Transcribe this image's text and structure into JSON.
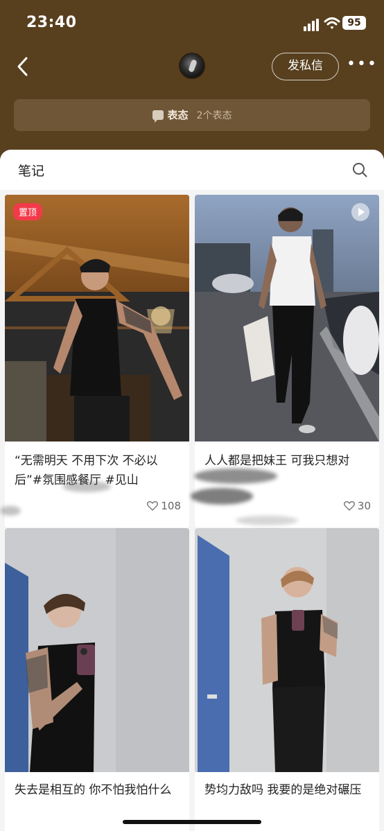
{
  "status_bar": {
    "time": "23:40",
    "battery": "95"
  },
  "header": {
    "dm_label": "发私信",
    "more_label": "•••"
  },
  "attitude": {
    "label": "表态",
    "count": "2个表态"
  },
  "notes": {
    "title": "笔记"
  },
  "cards": [
    {
      "badge": "置顶",
      "caption": "“无需明天 不用下次 不必以后”#氛围感餐厅 #见山",
      "likes": "108"
    },
    {
      "caption": "人人都是把妹王 可我只想对",
      "likes": "30"
    },
    {
      "caption": "失去是相互的 你不怕我怕什么"
    },
    {
      "caption": "势均力敌吗 我要的是绝对碾压"
    }
  ],
  "colors": {
    "header_bg": "#58401f",
    "badge": "#f23b4a"
  }
}
